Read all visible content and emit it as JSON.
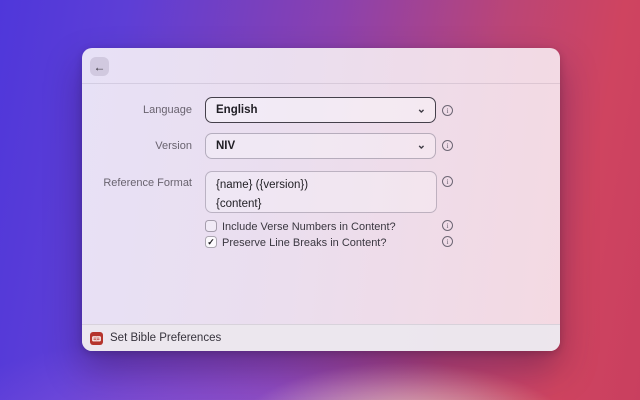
{
  "window": {
    "header": {
      "back_icon": "←"
    },
    "form": {
      "language": {
        "label": "Language",
        "value": "English"
      },
      "version": {
        "label": "Version",
        "value": "NIV"
      },
      "reference_format": {
        "label": "Reference Format",
        "line1": "{name} ({version})",
        "line2": "{content}"
      },
      "include_verse_numbers": {
        "label": "Include Verse Numbers in Content?",
        "checked": false
      },
      "preserve_line_breaks": {
        "label": "Preserve Line Breaks in Content?",
        "checked": true
      }
    },
    "footer": {
      "command_name": "Set Bible Preferences",
      "icon": "bible-book-icon"
    }
  },
  "icons": {
    "chevron": "⌄",
    "info": "i",
    "back": "←",
    "check": "✓"
  },
  "colors": {
    "accent_red_icon": "#b5342c",
    "background_left": "#4f37da",
    "background_right": "#c93f5f",
    "background_glow": "#f8e1ba",
    "window_tint_left": "#e7e1f6",
    "window_tint_right": "#f4d9e2",
    "focused_border": "#45404b"
  }
}
